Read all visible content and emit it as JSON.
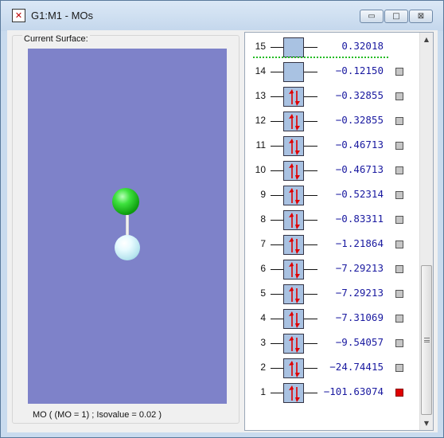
{
  "window": {
    "title": "G1:M1 - MOs",
    "minimize_glyph": "▭",
    "maximize_glyph": "□",
    "close_glyph": "⊠"
  },
  "surface": {
    "group_label": "Current Surface:",
    "status": "MO ( (MO = 1) ; Isovalue = 0.02 )",
    "atom_colors": {
      "chlorine": "#3ee23e",
      "hydrogen": "#d8f4fa"
    },
    "background_color": "#7e82c9"
  },
  "orbitals": [
    {
      "index": "15",
      "energy": "0.32018",
      "occupancy": 0,
      "has_checkbox": false,
      "selected": false
    },
    {
      "index": "14",
      "energy": "−0.12150",
      "occupancy": 0,
      "has_checkbox": true,
      "selected": false
    },
    {
      "index": "13",
      "energy": "−0.32855",
      "occupancy": 2,
      "has_checkbox": true,
      "selected": false
    },
    {
      "index": "12",
      "energy": "−0.32855",
      "occupancy": 2,
      "has_checkbox": true,
      "selected": false
    },
    {
      "index": "11",
      "energy": "−0.46713",
      "occupancy": 2,
      "has_checkbox": true,
      "selected": false
    },
    {
      "index": "10",
      "energy": "−0.46713",
      "occupancy": 2,
      "has_checkbox": true,
      "selected": false
    },
    {
      "index": "9",
      "energy": "−0.52314",
      "occupancy": 2,
      "has_checkbox": true,
      "selected": false
    },
    {
      "index": "8",
      "energy": "−0.83311",
      "occupancy": 2,
      "has_checkbox": true,
      "selected": false
    },
    {
      "index": "7",
      "energy": "−1.21864",
      "occupancy": 2,
      "has_checkbox": true,
      "selected": false
    },
    {
      "index": "6",
      "energy": "−7.29213",
      "occupancy": 2,
      "has_checkbox": true,
      "selected": false
    },
    {
      "index": "5",
      "energy": "−7.29213",
      "occupancy": 2,
      "has_checkbox": true,
      "selected": false
    },
    {
      "index": "4",
      "energy": "−7.31069",
      "occupancy": 2,
      "has_checkbox": true,
      "selected": false
    },
    {
      "index": "3",
      "energy": "−9.54057",
      "occupancy": 2,
      "has_checkbox": true,
      "selected": false
    },
    {
      "index": "2",
      "energy": "−24.74415",
      "occupancy": 2,
      "has_checkbox": true,
      "selected": false
    },
    {
      "index": "1",
      "energy": "−101.63074",
      "occupancy": 2,
      "has_checkbox": true,
      "selected": true
    }
  ],
  "colors": {
    "energy_text": "#1a1aa0",
    "level_box": "#a9c2e2",
    "electron_arrow": "#e00000",
    "homo_lumo_divider": "#22bb22",
    "selected_checkbox": "#e00000"
  }
}
